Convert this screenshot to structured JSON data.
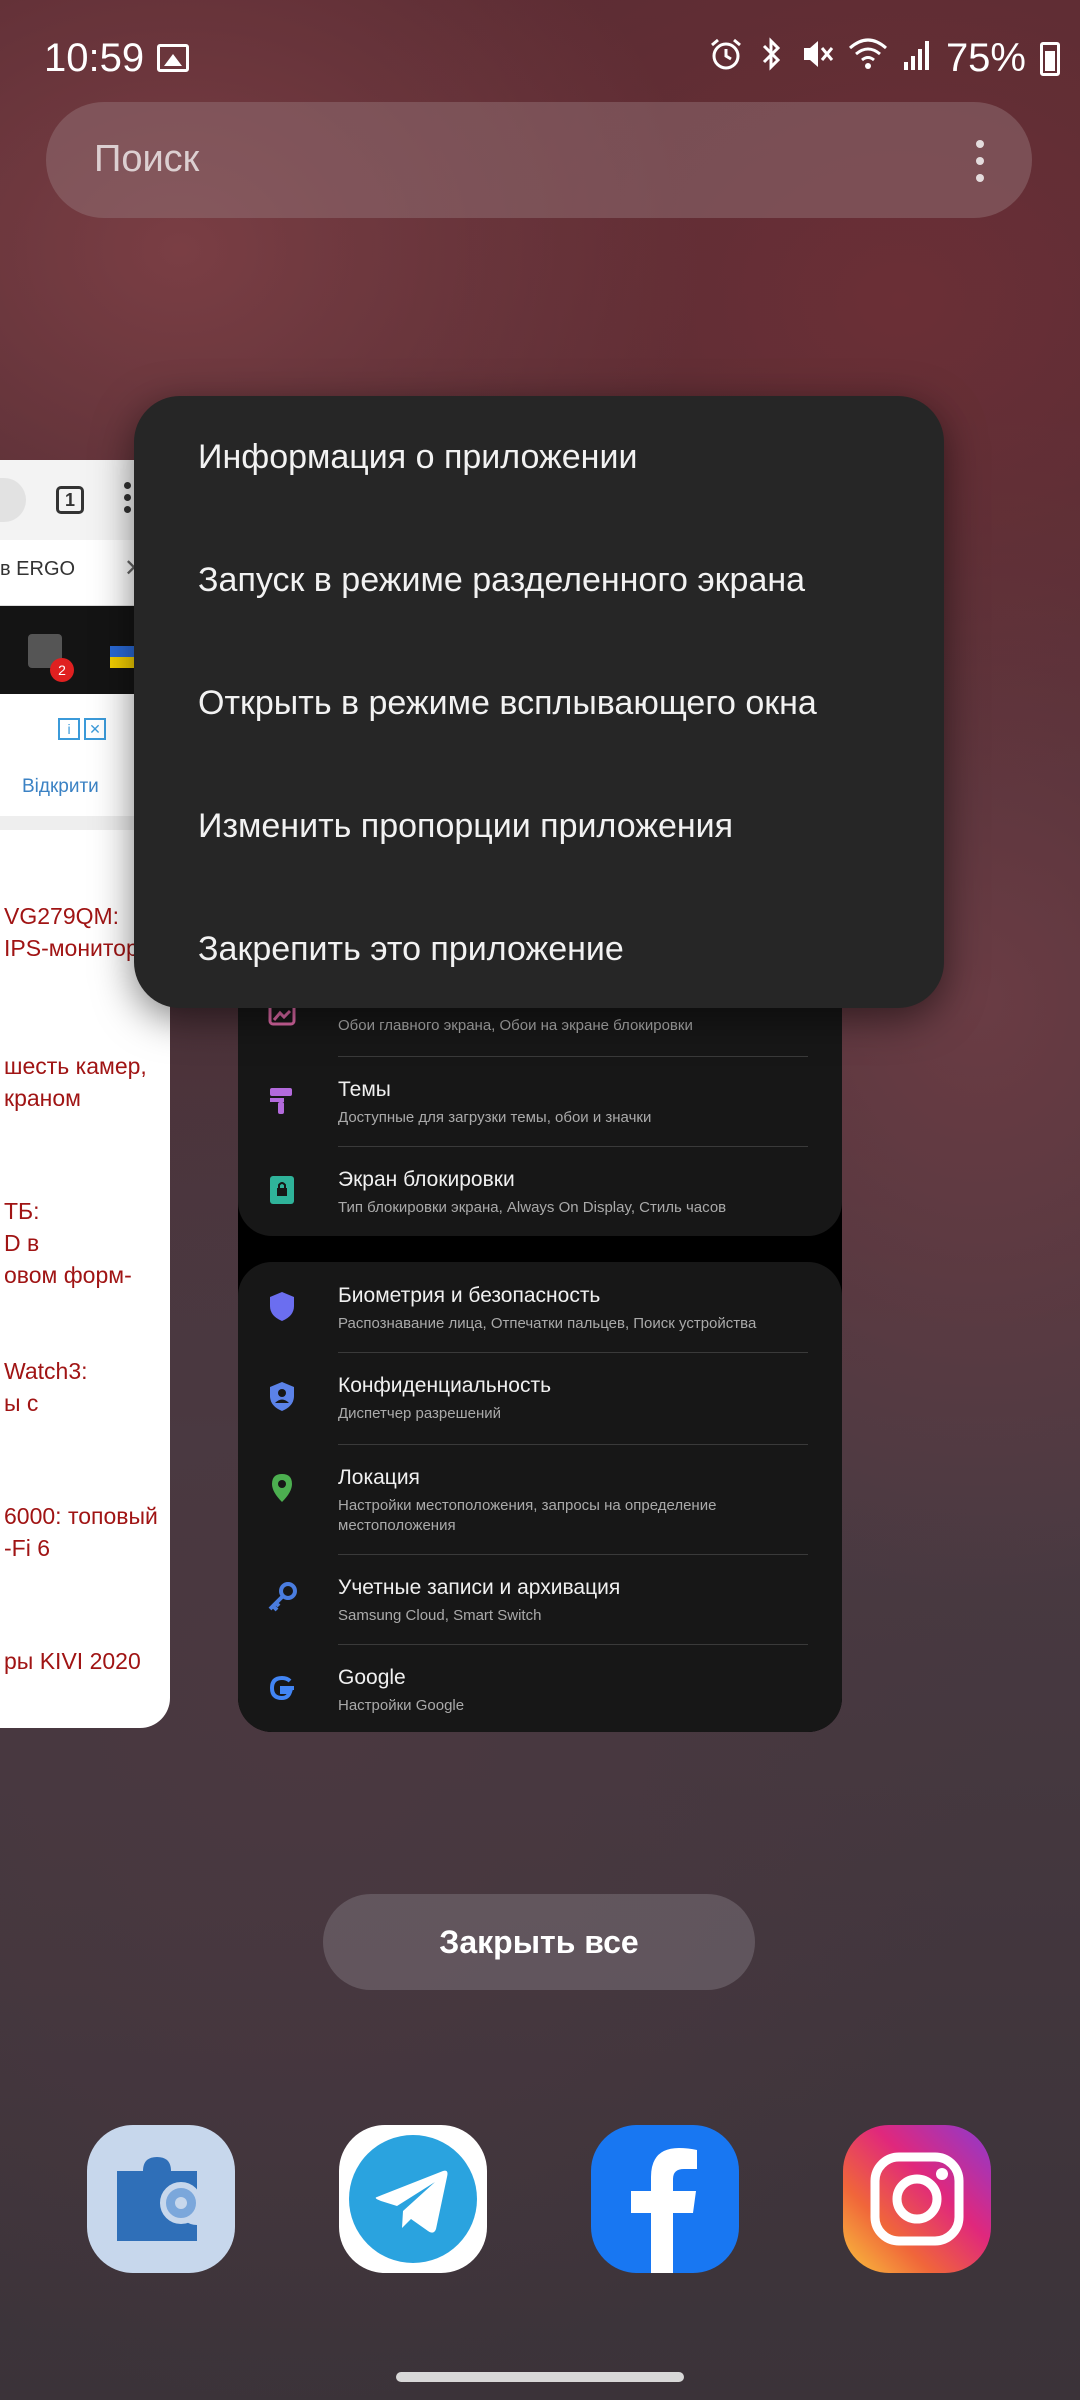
{
  "status_bar": {
    "time": "10:59",
    "battery": "75%",
    "icons": [
      "gallery-icon",
      "alarm-icon",
      "bluetooth-icon",
      "mute-icon",
      "wifi-icon",
      "signal-icon",
      "battery-icon"
    ]
  },
  "search": {
    "placeholder": "Поиск"
  },
  "browser_card": {
    "tabs_count": "1",
    "tab_title": "в ERGO",
    "tab_close": "✕",
    "badge_count": "2",
    "ad_open": "Відкрити",
    "news": [
      "VG279QM:\nIPS-монитор",
      "шесть камер,\nкраном",
      "ТБ:\nD в\nовом форм-",
      "Watch3:\nы с",
      "6000: топовый\n-Fi 6",
      "ры KIVI 2020"
    ]
  },
  "settings_card": {
    "rows": [
      {
        "title": "",
        "subtitle": "Обои главного экрана, Обои на экране блокировки"
      },
      {
        "title": "Темы",
        "subtitle": "Доступные для загрузки темы, обои и значки"
      },
      {
        "title": "Экран блокировки",
        "subtitle": "Тип блокировки экрана, Always On Display, Стиль часов"
      },
      {
        "title": "Биометрия и безопасность",
        "subtitle": "Распознавание лица, Отпечатки пальцев, Поиск устройства"
      },
      {
        "title": "Конфиденциальность",
        "subtitle": "Диспетчер разрешений"
      },
      {
        "title": "Локация",
        "subtitle": "Настройки местоположения, запросы на определение\nместоположения"
      },
      {
        "title": "Учетные записи и архивация",
        "subtitle": "Samsung Cloud, Smart Switch"
      },
      {
        "title": "Google",
        "subtitle": "Настройки Google"
      }
    ]
  },
  "context_menu": {
    "items": [
      "Информация о приложении",
      "Запуск в режиме разделенного экрана",
      "Открыть в режиме всплывающего окна",
      "Изменить пропорции приложения",
      "Закрепить это приложение"
    ]
  },
  "close_all": "Закрыть все",
  "dock": [
    "good-lock-app",
    "telegram-app",
    "facebook-app",
    "instagram-app"
  ],
  "colors": {
    "menu_bg": "#262626",
    "news_red": "#a01414",
    "telegram_blue": "#2aa3df",
    "facebook_blue": "#1877f2"
  }
}
